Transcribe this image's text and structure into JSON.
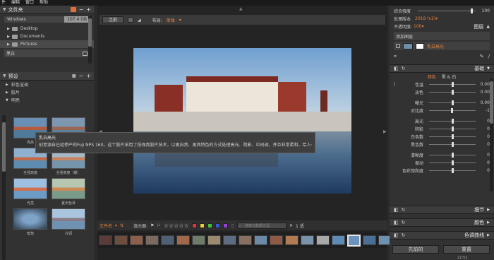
{
  "menu": [
    "件",
    "编辑",
    "窗口",
    "帮助"
  ],
  "folders": {
    "title": "文件夹",
    "drive": {
      "name": "Windows",
      "size": "107.4 GB"
    },
    "items": [
      "Desktop",
      "Documents",
      "Pictures"
    ],
    "favorite": "黑白"
  },
  "presets": {
    "title": "预设",
    "categories": [
      "彩色渲调",
      "胶片",
      "明亮"
    ],
    "thumbs": [
      "亮高",
      "",
      "全强高度",
      "全强高度（暖）",
      "光亮",
      "夏天色泽",
      "暗角",
      "冷调"
    ]
  },
  "toolbar": {
    "before_label": "之前",
    "layout_label": "布局:",
    "layout_value": "单独"
  },
  "tooltip": {
    "title": "乳白高光",
    "text": "创意源自已经停产的Fuji NPS 160。这个胶片采用了低保真胶片技术，以更自然、更具特色的方式处理高光、阴影、中间调，并且非常柔和。给人一种很旧的感觉。"
  },
  "bottombar": {
    "sort_label": "文件名",
    "filter_label": "选元器:",
    "search_placeholder": "搜索元数据过滤",
    "count": "1 适"
  },
  "right": {
    "strength_label": "综合强度",
    "strength_value": "100",
    "engine_label": "处理版本",
    "engine_value": "2018 (v2)",
    "opacity_label": "不透明度:",
    "opacity_value": "100",
    "layers_title": "图层",
    "add_layer": "添加图层",
    "layer_name": "乳白高光",
    "basic_title": "基础",
    "color_tab": "颜色",
    "bw_tab": "黑 & 白",
    "sliders": [
      {
        "label": "色温",
        "value": "0.00"
      },
      {
        "label": "淡色",
        "value": "0.00"
      },
      {
        "label": "曝光",
        "value": "0.00"
      },
      {
        "label": "对比度",
        "value": "-1"
      },
      {
        "label": "高光",
        "value": "0"
      },
      {
        "label": "阴影",
        "value": "0"
      },
      {
        "label": "白色数",
        "value": "0"
      },
      {
        "label": "黑色数",
        "value": "0"
      },
      {
        "label": "清晰度",
        "value": "0"
      },
      {
        "label": "振动",
        "value": "0"
      },
      {
        "label": "色彩饱和度",
        "value": "0"
      }
    ],
    "details_title": "细节",
    "color_title": "颜色",
    "curves_title": "色调曲线",
    "prev_button": "先前的",
    "reset_button": "重置",
    "time": "22:52"
  },
  "colors": {
    "accent": "#e8823f",
    "panel": "#323232"
  }
}
